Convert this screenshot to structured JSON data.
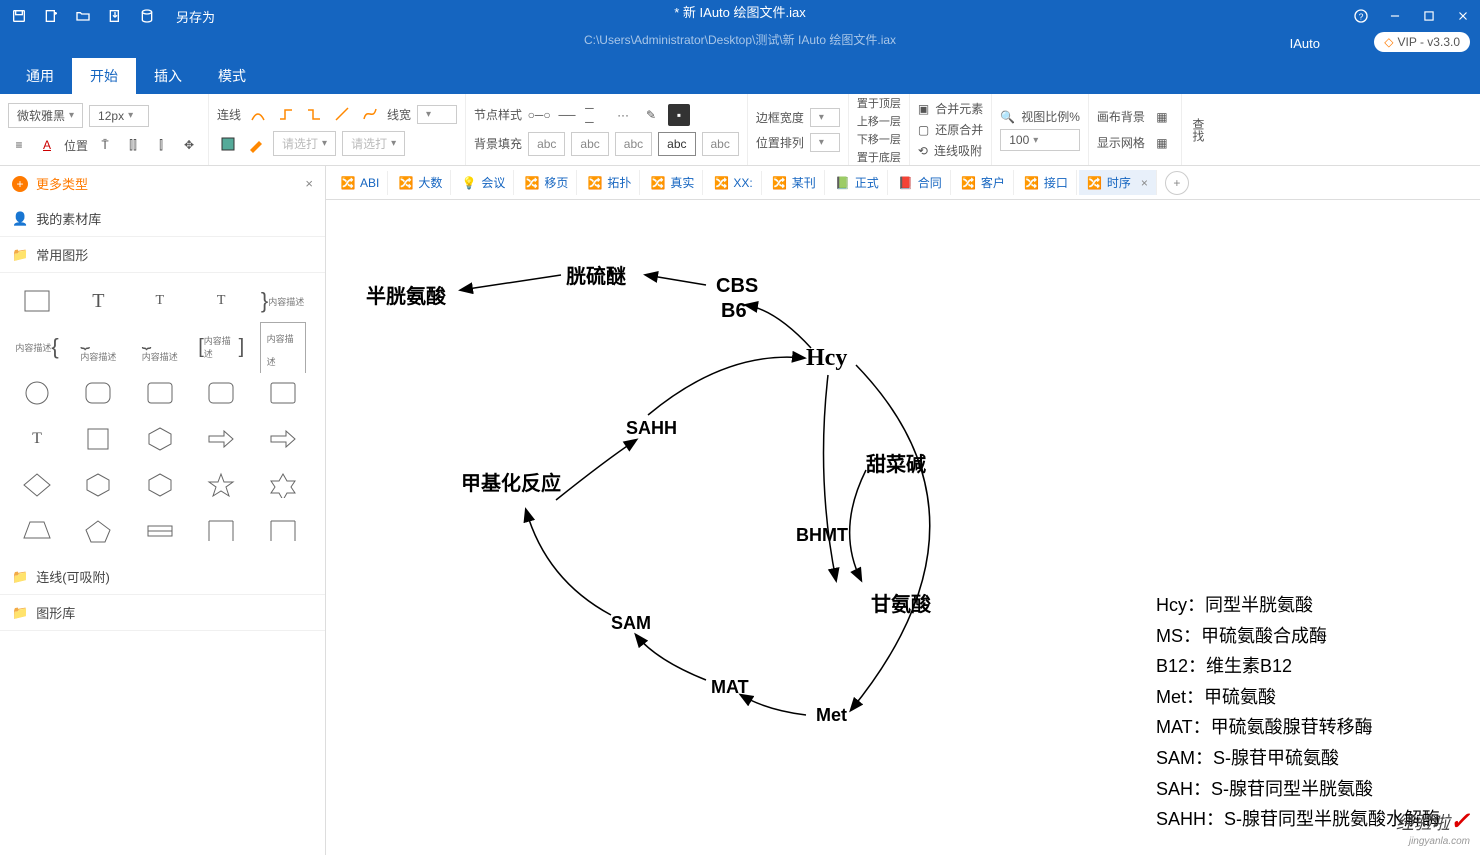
{
  "title": "* 新 IAuto 绘图文件.iax",
  "path": "C:\\Users\\Administrator\\Desktop\\测试\\新 IAuto 绘图文件.iax",
  "iauto": "IAuto",
  "vip": "VIP - v3.3.0",
  "save_as": "另存为",
  "menu": {
    "t0": "通用",
    "t1": "开始",
    "t2": "插入",
    "t3": "模式"
  },
  "ribbon": {
    "font": "微软雅黑",
    "size": "12px",
    "line": "连线",
    "linewidth": "线宽",
    "nodestyle": "节点样式",
    "pos": "位置",
    "sel1": "请选打",
    "sel2": "请选打",
    "bgfill": "背景填充",
    "abc": "abc",
    "borderw": "边框宽度",
    "posarr": "位置排列",
    "layer1": "置于顶层",
    "layer2": "上移一层",
    "layer3": "下移一层",
    "layer4": "置于底层",
    "merge": "合并元素",
    "unmerge": "还原合并",
    "snap": "连线吸附",
    "viewpct": "视图比例%",
    "viewval": "100",
    "canvasbg": "画布背景",
    "showgrid": "显示网格",
    "find": "查找"
  },
  "left": {
    "more": "更多类型",
    "my": "我的素材库",
    "common": "常用图形",
    "lines": "连线(可吸附)",
    "lib": "图形库",
    "desc": "内容描述"
  },
  "tabs": {
    "t0": "ABI",
    "t1": "大数",
    "t2": "会议",
    "t3": "移页",
    "t4": "拓扑",
    "t5": "真实",
    "t6": "XX:",
    "t7": "某刊",
    "t8": "正式",
    "t9": "合同",
    "t10": "客户",
    "t11": "接口",
    "t12": "时序"
  },
  "nodes": {
    "n1": "半胱氨酸",
    "n2": "胱硫醚",
    "n3": "CBS",
    "n3b": "B6",
    "n4": "Hcy",
    "n5": "SAHH",
    "n6": "甲基化反应",
    "n7": "甜菜碱",
    "n8": "BHMT",
    "n9": "甘氨酸",
    "n10": "SAM",
    "n11": "MAT",
    "n12": "Met"
  },
  "legend": {
    "l1": "Hcy：同型半胱氨酸",
    "l2": "MS：甲硫氨酸合成酶",
    "l3": "B12：维生素B12",
    "l4": "Met：甲硫氨酸",
    "l5": "MAT：甲硫氨酸腺苷转移酶",
    "l6": "SAM：S-腺苷甲硫氨酸",
    "l7": "SAH：S-腺苷同型半胱氨酸",
    "l8": "SAHH：S-腺苷同型半胱氨酸水解酶"
  },
  "watermark": "经验啦",
  "watermark_sub": "jingyanla.com"
}
